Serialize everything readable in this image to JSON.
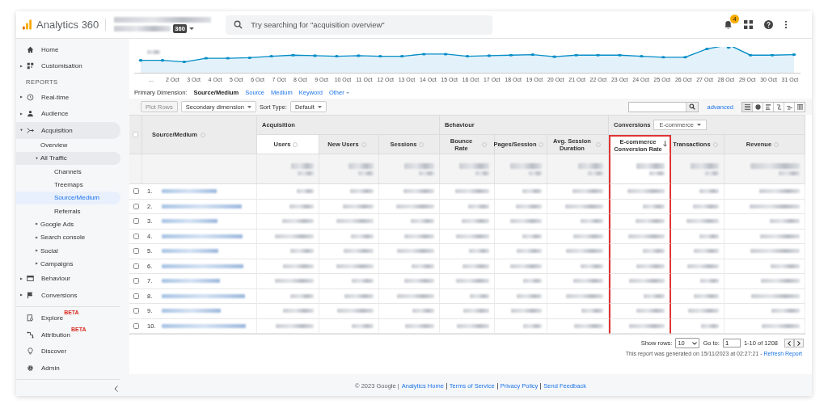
{
  "app": {
    "name": "Analytics 360",
    "account_badge": "360",
    "search_placeholder": "Try searching for \"acquisition overview\"",
    "notification_count": "4"
  },
  "sidebar": {
    "section_label": "REPORTS",
    "top": [
      {
        "label": "Home",
        "selected": false
      },
      {
        "label": "Customisation",
        "selected": false,
        "expanded": false
      }
    ],
    "reports": [
      {
        "label": "Real-time",
        "selected": false,
        "expanded": false
      },
      {
        "label": "Audience",
        "selected": false,
        "expanded": false
      },
      {
        "label": "Acquisition",
        "selected": false,
        "expanded": true,
        "children": [
          {
            "label": "Overview",
            "selected": false
          },
          {
            "label": "All Traffic",
            "selected": false,
            "expanded": true,
            "children": [
              {
                "label": "Channels",
                "selected": false
              },
              {
                "label": "Treemaps",
                "selected": false
              },
              {
                "label": "Source/Medium",
                "selected": true
              },
              {
                "label": "Referrals",
                "selected": false
              }
            ]
          },
          {
            "label": "Google Ads",
            "selected": false,
            "expanded": false
          },
          {
            "label": "Search console",
            "selected": false,
            "expanded": false
          },
          {
            "label": "Social",
            "selected": false,
            "expanded": false
          },
          {
            "label": "Campaigns",
            "selected": false,
            "expanded": false
          }
        ]
      },
      {
        "label": "Behaviour",
        "selected": false,
        "expanded": false
      },
      {
        "label": "Conversions",
        "selected": false,
        "expanded": false
      }
    ],
    "bottom": [
      {
        "label": "Explore",
        "badge": "BETA",
        "selected": false
      },
      {
        "label": "Attribution",
        "badge": "BETA",
        "selected": false
      },
      {
        "label": "Discover",
        "selected": false
      },
      {
        "label": "Admin",
        "selected": false
      }
    ]
  },
  "chart": {
    "x_labels": [
      "...",
      "2 Oct",
      "3 Oct",
      "4 Oct",
      "5 Oct",
      "6 Oct",
      "7 Oct",
      "8 Oct",
      "9 Oct",
      "10 Oct",
      "11 Oct",
      "12 Oct",
      "13 Oct",
      "14 Oct",
      "15 Oct",
      "16 Oct",
      "17 Oct",
      "18 Oct",
      "19 Oct",
      "20 Oct",
      "21 Oct",
      "22 Oct",
      "23 Oct",
      "24 Oct",
      "25 Oct",
      "26 Oct",
      "27 Oct",
      "28 Oct",
      "29 Oct",
      "30 Oct",
      "31 Oct"
    ]
  },
  "primary_dimension": {
    "label": "Primary Dimension:",
    "options": [
      {
        "label": "Source/Medium",
        "selected": true
      },
      {
        "label": "Source",
        "selected": false
      },
      {
        "label": "Medium",
        "selected": false
      },
      {
        "label": "Keyword",
        "selected": false
      },
      {
        "label": "Other",
        "selected": false
      }
    ]
  },
  "toolbar": {
    "plot_rows": {
      "label": "Plot Rows",
      "disabled": true
    },
    "secondary_dimension": "Secondary dimension",
    "sort_type_label": "Sort Type:",
    "sort_type": "Default",
    "advanced_link": "advanced",
    "views": [
      {
        "selected": true
      },
      {
        "selected": false
      },
      {
        "selected": false
      },
      {
        "selected": false
      },
      {
        "selected": false
      },
      {
        "selected": false
      }
    ]
  },
  "table": {
    "select_all": {
      "checked": false
    },
    "first_column": "Source/Medium",
    "groups": [
      {
        "label": "Acquisition",
        "columns": [
          {
            "label": "Users",
            "sorted": false,
            "highlighted": false
          },
          {
            "label": "New Users",
            "sorted": false,
            "highlighted": false
          },
          {
            "label": "Sessions",
            "sorted": false,
            "highlighted": false
          }
        ]
      },
      {
        "label": "Behaviour",
        "columns": [
          {
            "label": "Bounce Rate",
            "sorted": false,
            "highlighted": false
          },
          {
            "label": "Pages/Session",
            "sorted": false,
            "highlighted": false
          },
          {
            "label": "Avg. Session Duration",
            "sorted": false,
            "highlighted": false
          }
        ]
      },
      {
        "label": "Conversions",
        "dropdown": "E-commerce",
        "columns": [
          {
            "label": "E-commerce Conversion Rate",
            "sorted": true,
            "highlighted": true
          },
          {
            "label": "Transactions",
            "sorted": false,
            "highlighted": false
          },
          {
            "label": "Revenue",
            "sorted": false,
            "highlighted": false
          }
        ]
      }
    ],
    "rows": [
      {
        "number": "1.",
        "checked": false
      },
      {
        "number": "2.",
        "checked": false
      },
      {
        "number": "3.",
        "checked": false
      },
      {
        "number": "4.",
        "checked": false
      },
      {
        "number": "5.",
        "checked": false
      },
      {
        "number": "6.",
        "checked": false
      },
      {
        "number": "7.",
        "checked": false
      },
      {
        "number": "8.",
        "checked": false
      },
      {
        "number": "9.",
        "checked": false
      },
      {
        "number": "10.",
        "checked": false
      }
    ]
  },
  "pagination": {
    "show_rows_label": "Show rows:",
    "show_rows": "10",
    "go_to_label": "Go to:",
    "go_to": "1",
    "range": "1-10 of 1208"
  },
  "report_note": {
    "text": "This report was generated on 15/11/2023 at 02:27:21 -",
    "link": "Refresh Report"
  },
  "footer": {
    "copyright": "© 2023 Google |",
    "links": [
      "Analytics Home",
      "Terms of Service",
      "Privacy Policy",
      "Send Feedback"
    ]
  }
}
